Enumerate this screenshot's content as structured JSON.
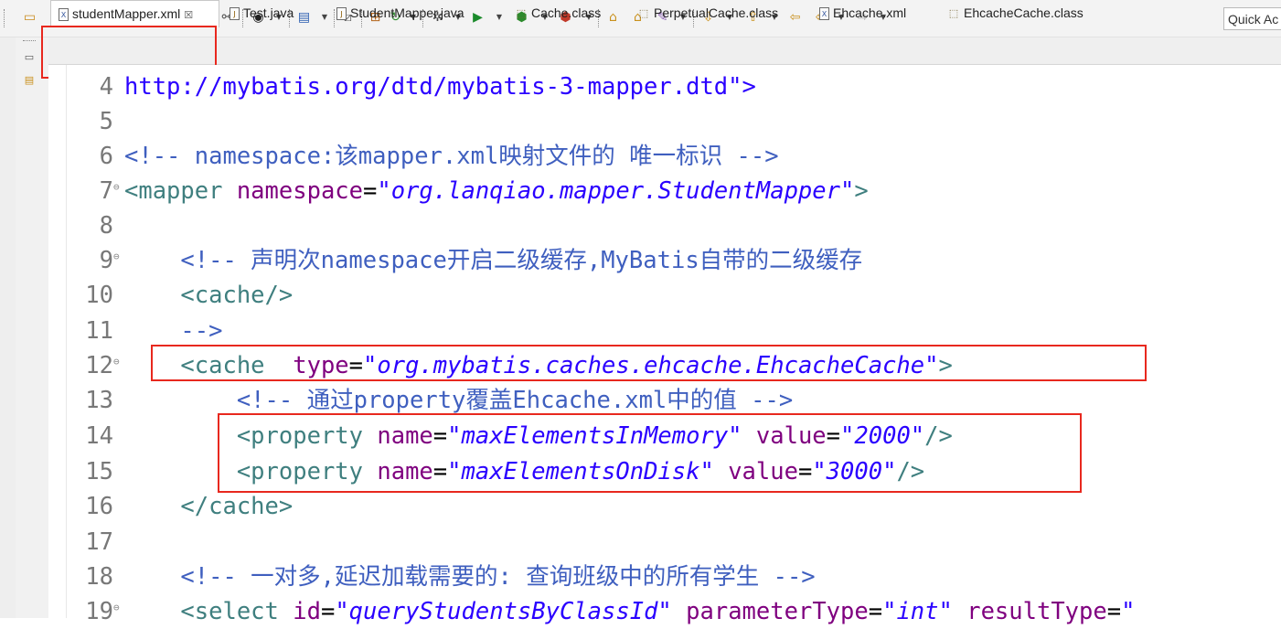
{
  "quick_access": {
    "label": "Quick Ac"
  },
  "tabs": [
    {
      "label": "studentMapper.xml",
      "icon": "xml-file-icon",
      "active": true
    },
    {
      "label": "Test.java",
      "icon": "java-file-icon"
    },
    {
      "label": "StudentMapper.java",
      "icon": "java-file-icon"
    },
    {
      "label": "Cache.class",
      "icon": "class-file-icon"
    },
    {
      "label": "PerpetualCache.class",
      "icon": "class-file-icon"
    },
    {
      "label": "Ehcache.xml",
      "icon": "xml-file-icon"
    },
    {
      "label": "EhcacheCache.class",
      "icon": "class-file-icon"
    }
  ],
  "editor": {
    "lines": [
      {
        "num": "4",
        "text": "http://mybatis.org/dtd/mybatis-3-mapper.dtd\">"
      },
      {
        "num": "5",
        "text": ""
      },
      {
        "num": "6",
        "text": "<!-- namespace:该mapper.xml映射文件的 唯一标识 -->"
      },
      {
        "num": "7",
        "tag_open": "<mapper ",
        "attr": "namespace",
        "eq": "=",
        "val": "\"org.lanqiao.mapper.StudentMapper\"",
        "tag_close": ">"
      },
      {
        "num": "8",
        "text": ""
      },
      {
        "num": "9",
        "text": "<!-- 声明次namespace开启二级缓存,MyBatis自带的二级缓存"
      },
      {
        "num": "10",
        "text": "<cache/>"
      },
      {
        "num": "11",
        "text": "-->"
      },
      {
        "num": "12",
        "tag_open": "<cache  ",
        "attr": "type",
        "eq": "=",
        "val": "\"org.mybatis.caches.ehcache.EhcacheCache\"",
        "tag_close": ">"
      },
      {
        "num": "13",
        "text": "<!-- 通过property覆盖Ehcache.xml中的值 -->"
      },
      {
        "num": "14",
        "tag_open": "<property ",
        "attr": "name",
        "eq": "=",
        "val": "\"maxElementsInMemory\"",
        "attr2": " value",
        "val2": "\"2000\"",
        "tag_close": "/>"
      },
      {
        "num": "15",
        "tag_open": "<property ",
        "attr": "name",
        "eq": "=",
        "val": "\"maxElementsOnDisk\"",
        "attr2": " value",
        "val2": "\"3000\"",
        "tag_close": "/>"
      },
      {
        "num": "16",
        "text": "</cache>"
      },
      {
        "num": "17",
        "text": ""
      },
      {
        "num": "18",
        "text": "<!-- 一对多,延迟加载需要的: 查询班级中的所有学生 -->"
      },
      {
        "num": "19",
        "tag_open": "<select ",
        "attr": "id",
        "eq": "=",
        "val": "\"queryStudentsByClassId\"",
        "attr2": " parameterType",
        "val2": "\"int\"",
        "attr3": " resultType",
        "val3": "\""
      }
    ]
  },
  "colors": {
    "highlight": "#e8281e",
    "comment": "#3f5fbf",
    "tag": "#3f7f7f",
    "attr": "#7f007f",
    "value": "#2a00ff"
  }
}
